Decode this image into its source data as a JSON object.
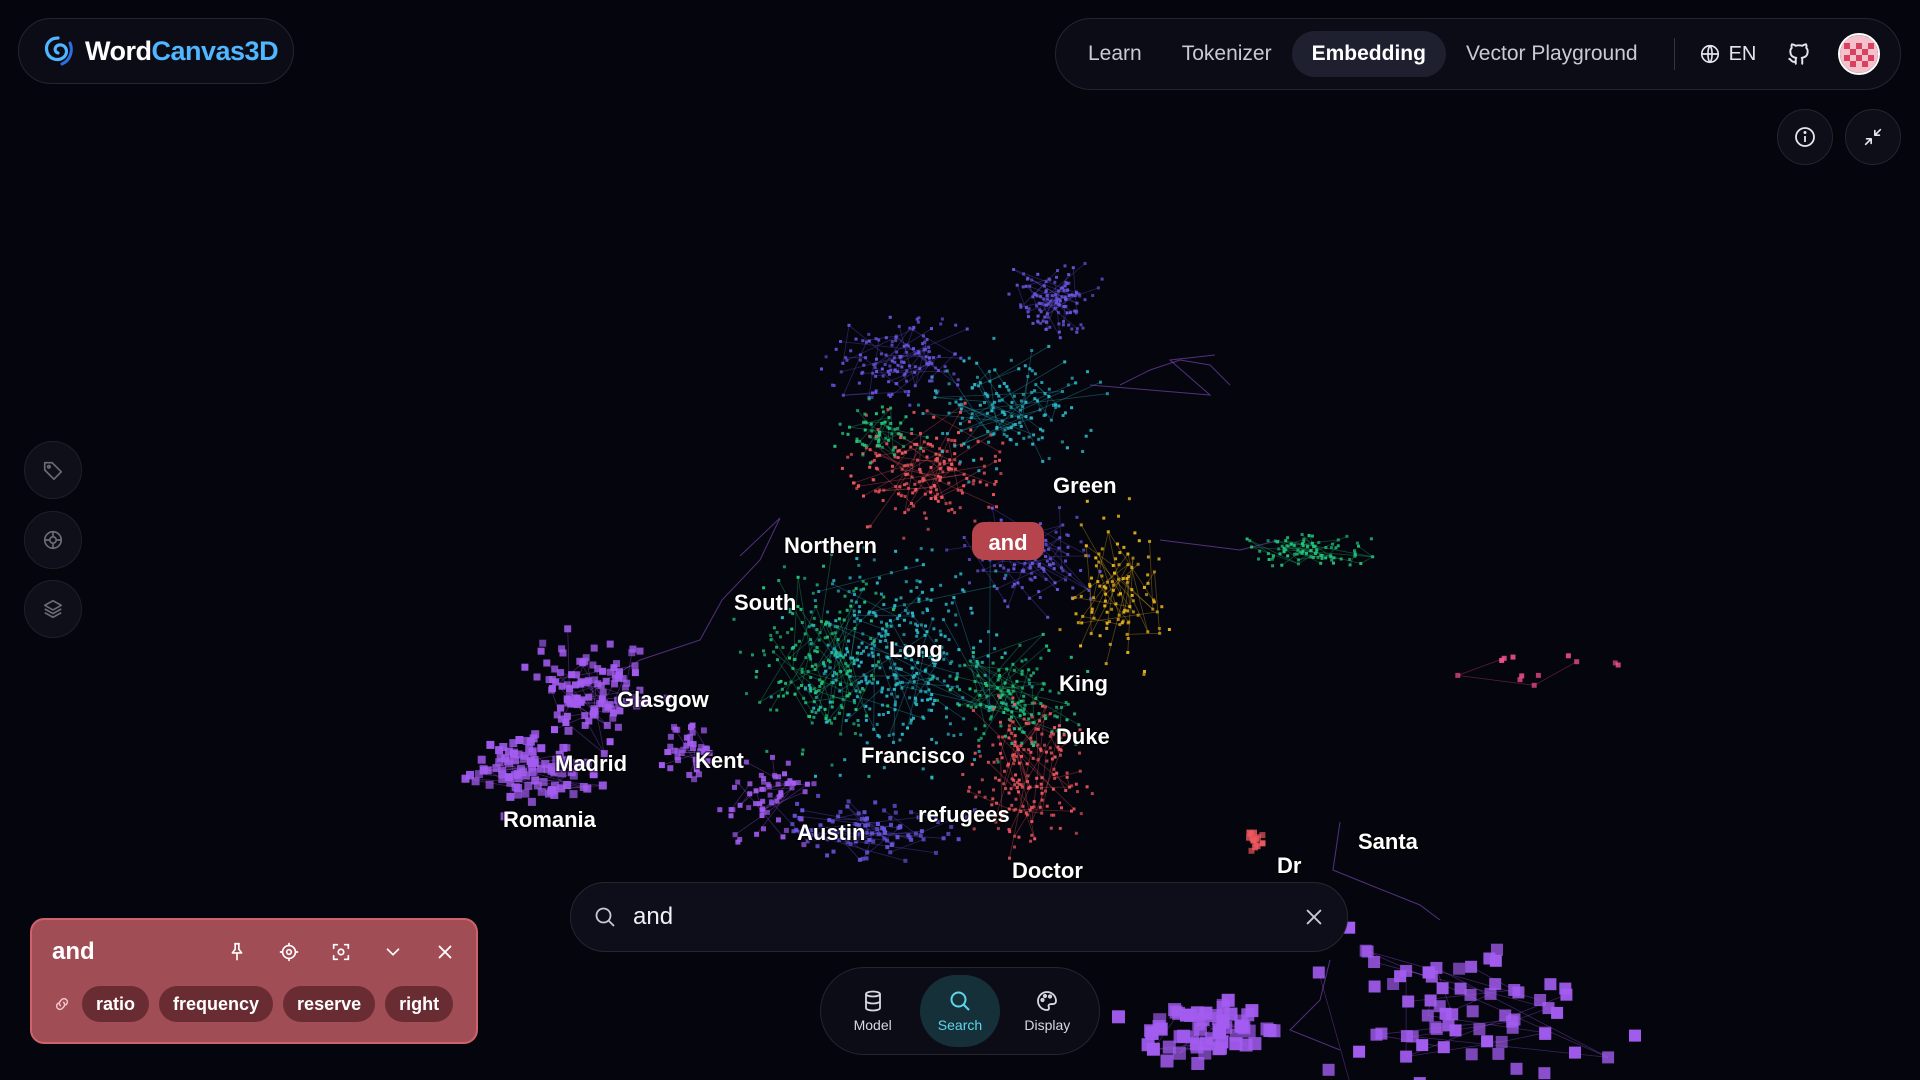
{
  "app": {
    "name_part1": "Word",
    "name_part2": "Canvas3D"
  },
  "nav": {
    "items": [
      "Learn",
      "Tokenizer",
      "Embedding",
      "Vector Playground"
    ],
    "active": "Embedding",
    "language": "EN"
  },
  "search": {
    "value": "and"
  },
  "dock": {
    "model_label": "Model",
    "search_label": "Search",
    "display_label": "Display",
    "active": "Search"
  },
  "word_card": {
    "word": "and",
    "related": [
      "ratio",
      "frequency",
      "reserve",
      "right"
    ]
  },
  "scene_labels": {
    "highlight": "and",
    "green": "Green",
    "northern": "Northern",
    "south": "South",
    "long": "Long",
    "glasgow": "Glasgow",
    "king": "King",
    "duke": "Duke",
    "madrid": "Madrid",
    "kent": "Kent",
    "francisco": "Francisco",
    "romania": "Romania",
    "refugees": "refugees",
    "austin": "Austin",
    "santa": "Santa",
    "dr": "Dr",
    "doctor": "Doctor"
  },
  "colors": {
    "accent": "#4fb6ff",
    "cluster_purple": "#a35cf0",
    "cluster_indigo": "#6b55e0",
    "cluster_teal": "#2bb9c9",
    "cluster_green": "#22c47a",
    "cluster_red": "#f0585e",
    "cluster_yellow": "#e8b51c",
    "cluster_pink": "#f0508a",
    "card_bg": "#a14d55",
    "dock_active": "#16303a"
  }
}
